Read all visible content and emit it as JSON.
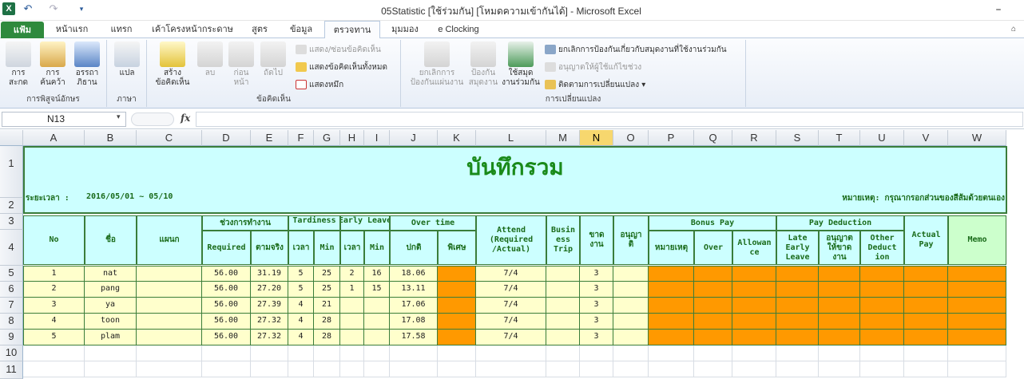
{
  "window": {
    "title": "05Statistic  [ใช้ร่วมกัน]  [โหมดความเข้ากันได้] - Microsoft Excel",
    "app_icon": "X",
    "minimize": "–"
  },
  "tabs": [
    "แฟ้ม",
    "หน้าแรก",
    "แทรก",
    "เค้าโครงหน้ากระดาษ",
    "สูตร",
    "ข้อมูล",
    "ตรวจทาน",
    "มุมมอง",
    "e Clocking"
  ],
  "ribbon": {
    "proofing": {
      "label": "การพิสูจน์อักษร",
      "spell": "การ\nสะกด",
      "research": "การ\nค้นคว้า",
      "thesaurus": "อรรถา\nภิธาน"
    },
    "language": {
      "label": "ภาษา",
      "translate": "แปล"
    },
    "comments": {
      "label": "ข้อคิดเห็น",
      "new": "สร้าง\nข้อคิดเห็น",
      "delete": "ลบ",
      "prev": "ก่อน\nหน้า",
      "next": "ถัดไป",
      "show_hide": "แสดง/ซ่อนข้อคิดเห็น",
      "show_all": "แสดงข้อคิดเห็นทั้งหมด",
      "show_ink": "แสดงหมึก"
    },
    "changes": {
      "label": "การเปลี่ยนแปลง",
      "protect_sheet": "ยกเลิกการ\nป้องกันแผ่นงาน",
      "protect_wb": "ป้องกัน\nสมุดงาน",
      "share_wb": "ใช้สมุด\nงานร่วมกัน",
      "unprotect_shared": "ยกเลิกการป้องกันเกี่ยวกับสมุดงานที่ใช้งานร่วมกัน",
      "allow_edit": "อนุญาตให้ผู้ใช้แก้ไขช่วง",
      "track": "ติดตามการเปลี่ยนแปลง ▾"
    }
  },
  "formula_bar": {
    "namebox": "N13",
    "fx": "fx",
    "value": ""
  },
  "columns": [
    "A",
    "B",
    "C",
    "D",
    "E",
    "F",
    "G",
    "H",
    "I",
    "J",
    "K",
    "L",
    "M",
    "N",
    "O",
    "P",
    "Q",
    "R",
    "S",
    "T",
    "U",
    "V",
    "W"
  ],
  "selected_column": "N",
  "rows": [
    "1",
    "2",
    "3",
    "4",
    "5",
    "6",
    "7",
    "8",
    "9",
    "10",
    "11"
  ],
  "sheet": {
    "title": "บันทึกรวม",
    "period_label": "ระยะเวลา :",
    "period_value": "2016/05/01 ~ 05/10",
    "note": "หมายเหตุ: กรุณากรอกส่วนของสีส้มด้วยตนเอง",
    "headers": {
      "no": "No",
      "name": "ชื่อ",
      "dept": "แผนก",
      "work_period": "ช่วงการทำงาน",
      "required": "Required",
      "actual": "ตามจริง",
      "tardiness": "Tardiness",
      "t_time": "เวลา",
      "t_min": "Min",
      "early": "Early Leave",
      "e_time": "เวลา",
      "e_min": "Min",
      "overtime": "Over time",
      "ot_normal": "ปกติ",
      "ot_special": "พิเศษ",
      "attend": "Attend\n(Required\n/Actual)",
      "business": "Busin\ness\nTrip",
      "absent": "ขาด\nงาน",
      "permit": "อนุญา\nติ",
      "bonus": "Bonus Pay",
      "b_note": "หมายเหตุ",
      "b_over": "Over",
      "b_allow": "Allowan\nce",
      "deduct": "Pay Deduction",
      "d_late": "Late\nEarly\nLeave",
      "d_permit": "อนุญาต\nให้ขาด\nงาน",
      "d_other": "Other\nDeduct\nion",
      "actual_pay": "Actual\nPay",
      "memo": "Memo"
    },
    "data": [
      {
        "no": "1",
        "name": "nat",
        "required": "56.00",
        "actual": "31.19",
        "t_time": "5",
        "t_min": "25",
        "e_time": "2",
        "e_min": "16",
        "ot": "18.06",
        "attend": "7/4",
        "absent": "3"
      },
      {
        "no": "2",
        "name": "pang",
        "required": "56.00",
        "actual": "27.20",
        "t_time": "5",
        "t_min": "25",
        "e_time": "1",
        "e_min": "15",
        "ot": "13.11",
        "attend": "7/4",
        "absent": "3"
      },
      {
        "no": "3",
        "name": "ya",
        "required": "56.00",
        "actual": "27.39",
        "t_time": "4",
        "t_min": "21",
        "e_time": "",
        "e_min": "",
        "ot": "17.06",
        "attend": "7/4",
        "absent": "3"
      },
      {
        "no": "4",
        "name": "toon",
        "required": "56.00",
        "actual": "27.32",
        "t_time": "4",
        "t_min": "28",
        "e_time": "",
        "e_min": "",
        "ot": "17.08",
        "attend": "7/4",
        "absent": "3"
      },
      {
        "no": "5",
        "name": "plam",
        "required": "56.00",
        "actual": "27.32",
        "t_time": "4",
        "t_min": "28",
        "e_time": "",
        "e_min": "",
        "ot": "17.58",
        "attend": "7/4",
        "absent": "3"
      }
    ]
  }
}
